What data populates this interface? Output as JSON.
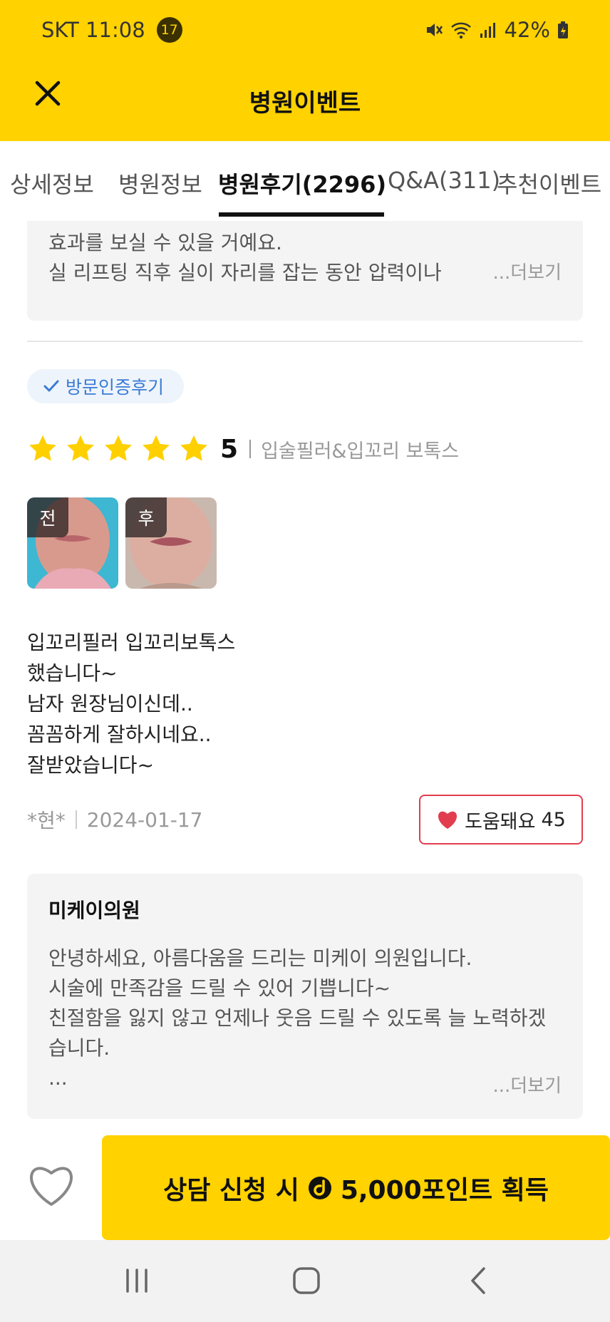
{
  "status_bar": {
    "carrier_time": "SKT 11:08",
    "notif_count": "17",
    "battery": "42%"
  },
  "app_bar": {
    "title": "병원이벤트"
  },
  "tabs": [
    {
      "label": "상세정보"
    },
    {
      "label": "병원정보"
    },
    {
      "label": "병원후기(2296)",
      "active": true
    },
    {
      "label": "Q&A(311)"
    },
    {
      "label": "추천이벤트"
    }
  ],
  "prev_reply": {
    "line1": "효과를 보실 수 있을 거예요.",
    "line2": "실 리프팅 직후 실이 자리를 잡는 동안 압력이나",
    "more": "...더보기"
  },
  "review": {
    "badge": "방문인증후기",
    "rating": "5",
    "treatment": "입술필러&입꼬리 보톡스",
    "photo_labels": {
      "before": "전",
      "after": "후"
    },
    "text_lines": [
      "입꼬리필러 입꼬리보톡스",
      "했습니다~",
      "남자 원장님이신데..",
      "꼼꼼하게 잘하시네요..",
      "잘받았습니다~"
    ],
    "author": "*현*",
    "date": "2024-01-17",
    "helpful_label": "도움돼요",
    "helpful_count": "45"
  },
  "clinic_reply": {
    "name": "미케이의원",
    "lines": [
      "안녕하세요, 아름다움을 드리는 미케이 의원입니다.",
      "시술에 만족감을 드릴 수 있어 기쁩니다~",
      "친절함을 잃지 않고 언제나 웃음 드릴 수 있도록 늘 노력하겠",
      "습니다.",
      "..."
    ],
    "more": "...더보기"
  },
  "bottom": {
    "cta_prefix": "상담 신청 시",
    "cta_suffix": "5,000포인트 획득"
  },
  "colors": {
    "brand_yellow": "#ffd200",
    "star_yellow": "#ffd000",
    "heart_red": "#e23d4f",
    "badge_blue": "#3a7bd5"
  }
}
